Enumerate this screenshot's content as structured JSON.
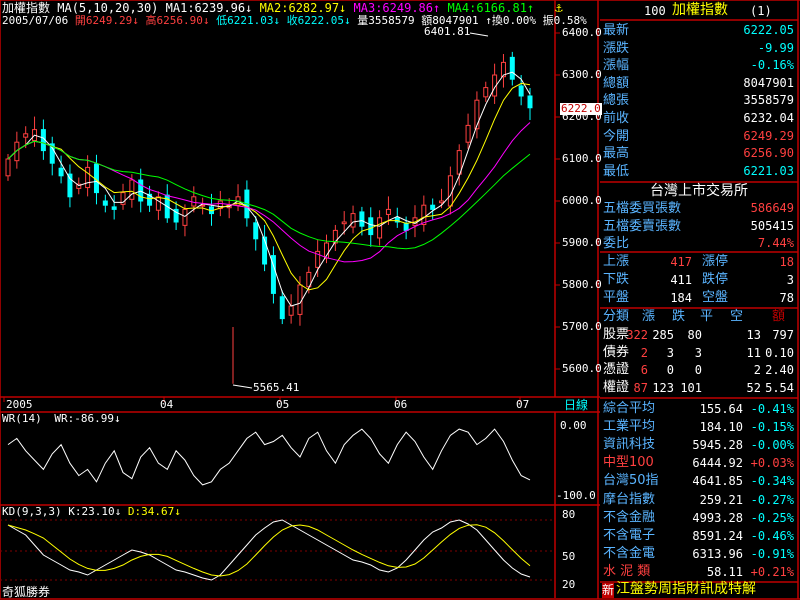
{
  "header": {
    "title": "加權指數",
    "ma_label": "MA(5,10,20,30)",
    "ma1": "MA1:6239.96↓",
    "ma2": "MA2:6282.97↓",
    "ma3": "MA3:6249.86↑",
    "ma4": "MA4:6166.81↑",
    "date": "2005/07/06",
    "open": "開6249.29↓",
    "high": "高6256.90↓",
    "low": "低6221.03↓",
    "close": "收6222.05↓",
    "vol": "量3558579",
    "amount": "額8047901",
    "chg": "↑換0.00%",
    "amp": "振0.58%",
    "colors": {
      "ma1": "#ffffff",
      "ma2": "#ffff00",
      "ma3": "#ff00ff",
      "ma4": "#00ff00",
      "up": "#ff4040",
      "down": "#00ffff"
    }
  },
  "price_axis": [
    "6400.0",
    "6300.0",
    "6200.0",
    "6100.0",
    "6000.0",
    "5900.0",
    "5800.0",
    "5700.0",
    "5600.0"
  ],
  "price_marker": "6222.0",
  "annot_high": "6401.81",
  "annot_low": "5565.41",
  "x_axis": [
    "2005",
    "04",
    "05",
    "06",
    "07"
  ],
  "x_unit": "日線",
  "wr": {
    "label": "WR(14)",
    "value": "WR:-86.99↓",
    "axis": [
      "0.00",
      "-100.0"
    ]
  },
  "kd": {
    "label": "KD(9,3,3)",
    "k": "K:23.10↓",
    "d": "D:34.67↓",
    "axis": [
      "80",
      "50",
      "20"
    ]
  },
  "footer_left": "奇狐勝券",
  "panel": {
    "title_num": "100",
    "title": "加權指數",
    "title_suffix": "(1)",
    "rows": [
      {
        "label": "最新",
        "value": "6222.05",
        "color": "#00ffff"
      },
      {
        "label": "漲跌",
        "value": "-9.99",
        "color": "#00ffff"
      },
      {
        "label": "漲幅",
        "value": "-0.16%",
        "color": "#00ffff"
      },
      {
        "label": "總額",
        "value": "8047901",
        "color": "#ffffff"
      },
      {
        "label": "總張",
        "value": "3558579",
        "color": "#ffffff"
      },
      {
        "label": "前收",
        "value": "6232.04",
        "color": "#ffffff"
      },
      {
        "label": "今開",
        "value": "6249.29",
        "color": "#ff4040"
      },
      {
        "label": "最高",
        "value": "6256.90",
        "color": "#ff4040"
      },
      {
        "label": "最低",
        "value": "6221.03",
        "color": "#00ffff"
      }
    ],
    "market_title": "台灣上市交易所",
    "order_rows": [
      {
        "label": "五檔委買張數",
        "value": "586649",
        "color": "#ff4040"
      },
      {
        "label": "五檔委賣張數",
        "value": "505415",
        "color": "#ffffff"
      },
      {
        "label": "委比",
        "value": "7.44%",
        "color": "#ff4040"
      }
    ],
    "stats": [
      {
        "l1": "上漲",
        "v1": "417",
        "c1": "#ff4040",
        "l2": "漲停",
        "v2": "18",
        "c2": "#ff4040"
      },
      {
        "l1": "下跌",
        "v1": "411",
        "c1": "#ffffff",
        "l2": "跌停",
        "v2": "3",
        "c2": "#ffffff"
      },
      {
        "l1": "平盤",
        "v1": "184",
        "c1": "#ffffff",
        "l2": "空盤",
        "v2": "78",
        "c2": "#ffffff"
      }
    ],
    "cls_header": [
      "分類",
      "漲",
      "跌",
      "平",
      "空",
      "額"
    ],
    "cls_rows": [
      {
        "name": "股票",
        "up": "322",
        "down": "285",
        "flat": "80",
        "empty": "13",
        "amt": "797"
      },
      {
        "name": "債券",
        "up": "2",
        "down": "3",
        "flat": "3",
        "empty": "11",
        "amt": "0.10"
      },
      {
        "name": "憑證",
        "up": "6",
        "down": "0",
        "flat": "0",
        "empty": "2",
        "amt": "2.40"
      },
      {
        "name": "權證",
        "up": "87",
        "down": "123",
        "flat": "101",
        "empty": "52",
        "amt": "5.54"
      }
    ],
    "indices": [
      {
        "name": "綜合平均",
        "value": "155.64",
        "chg": "-0.41%",
        "nc": "#5ab4ff",
        "cc": "#00ffff"
      },
      {
        "name": "工業平均",
        "value": "184.10",
        "chg": "-0.15%",
        "nc": "#5ab4ff",
        "cc": "#00ffff"
      },
      {
        "name": "資訊科技",
        "value": "5945.28",
        "chg": "-0.00%",
        "nc": "#5ab4ff",
        "cc": "#00ffff"
      },
      {
        "name": "中型100",
        "value": "6444.92",
        "chg": "+0.03%",
        "nc": "#ff4040",
        "cc": "#ff4040"
      },
      {
        "name": "台灣50指",
        "value": "4641.85",
        "chg": "-0.34%",
        "nc": "#5ab4ff",
        "cc": "#00ffff"
      },
      {
        "name": "摩台指數",
        "value": "259.21",
        "chg": "-0.27%",
        "nc": "#5ab4ff",
        "cc": "#00ffff"
      },
      {
        "name": "不含金融",
        "value": "4993.28",
        "chg": "-0.25%",
        "nc": "#5ab4ff",
        "cc": "#00ffff"
      },
      {
        "name": "不含電子",
        "value": "8591.24",
        "chg": "-0.46%",
        "nc": "#5ab4ff",
        "cc": "#00ffff"
      },
      {
        "name": "不含金電",
        "value": "6313.96",
        "chg": "-0.91%",
        "nc": "#5ab4ff",
        "cc": "#00ffff"
      },
      {
        "name": "水 泥 類",
        "value": "58.11",
        "chg": "+0.21%",
        "nc": "#ff4040",
        "cc": "#ff4040"
      }
    ],
    "ticker_tag": "新",
    "ticker": "江盤勢周指財訊成特解"
  }
}
